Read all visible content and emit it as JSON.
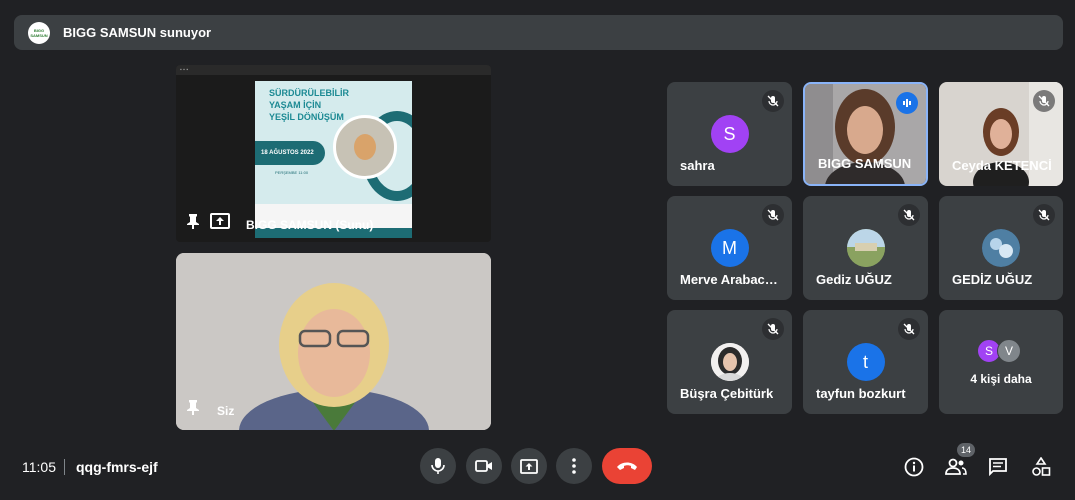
{
  "banner": {
    "logo_text": "BIGG SAMSUN",
    "text": "BIGG SAMSUN sunuyor"
  },
  "presentation": {
    "slide_title": "SÜRDÜRÜLEBİLİR YAŞAM İÇİN YEŞİL DÖNÜŞÜM",
    "slide_date": "18 AĞUSTOS 2022",
    "slide_day": "PERŞEMBE 11:00",
    "label": "BIGG SAMSUN (Sunu)"
  },
  "self_view": {
    "label": "Siz"
  },
  "participants": [
    {
      "name": "sahra",
      "initial": "S",
      "color": "#a142f4",
      "muted": true
    },
    {
      "name": "BIGG SAMSUN",
      "speaking": true
    },
    {
      "name": "Ceyda KETENCİ",
      "muted": true
    },
    {
      "name": "Merve Arabacı ...",
      "initial": "M",
      "color": "#1a73e8",
      "muted": true
    },
    {
      "name": "Gediz UĞUZ",
      "muted": true
    },
    {
      "name": "GEDİZ UĞUZ",
      "muted": true
    },
    {
      "name": "Büşra Çebitürk",
      "muted": true
    },
    {
      "name": "tayfun bozkurt",
      "initial": "t",
      "color": "#1a73e8",
      "muted": true
    }
  ],
  "more_people": {
    "label": "4 kişi daha",
    "initials": [
      "S",
      "V"
    ],
    "colors": [
      "#a142f4",
      "#80868b"
    ]
  },
  "bottom_bar": {
    "time": "11:05",
    "meeting_code": "qqg-fmrs-ejf",
    "participant_count": "14"
  }
}
